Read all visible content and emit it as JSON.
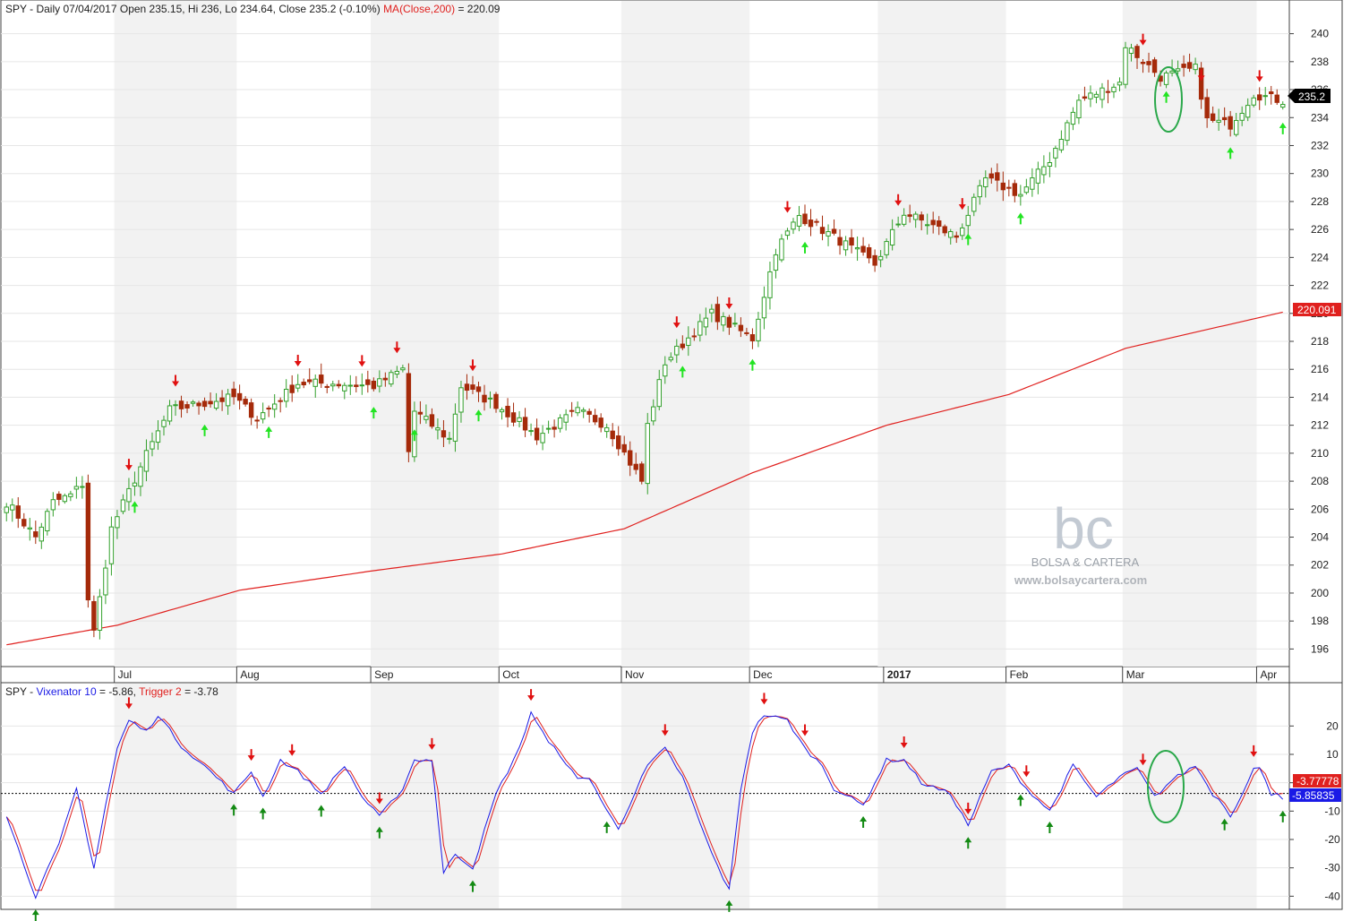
{
  "price_panel": {
    "header": {
      "prefix": "SPY - Daily 07/04/2017 Open 235.15, Hi 236, Lo 234.64, Close 235.2 (-0.10%)",
      "ma_label": "MA(Close,200)",
      "ma_value": "= 220.09"
    },
    "last_price_label": "235.2",
    "ma_price_label": "220.091"
  },
  "indicator_panel": {
    "header": {
      "prefix": "SPY - ",
      "vix_label": "Vixenator 10",
      "vix_value": "= -5.86,",
      "trigger_label": "Trigger 2",
      "trigger_value": "= -3.78"
    },
    "trigger_last_label": "-3.77778",
    "vix_last_label": "-5.85835"
  },
  "watermark": {
    "logo_letters": "bc",
    "name": "BOLSA & CARTERA",
    "url": "www.bolsaycartera.com"
  },
  "colors": {
    "up_candle": "#33a02c",
    "down_candle": "#a52a0a",
    "ma_line": "#e0201e",
    "vix_line": "#1a1ae6",
    "trigger_line": "#e0201e",
    "arrow_up_price": "#22e422",
    "arrow_up_indicator": "#138a13",
    "arrow_down": "#e01010",
    "circle": "#2aa84a",
    "shading": "#f2f2f2"
  },
  "chart_data": [
    {
      "type": "candlestick",
      "ylim": [
        195,
        241
      ],
      "y_ticks": [
        196,
        198,
        200,
        202,
        204,
        206,
        208,
        210,
        212,
        214,
        216,
        218,
        220,
        222,
        224,
        226,
        228,
        230,
        232,
        234,
        236,
        238,
        240
      ],
      "x_ticks": [
        {
          "label": "Jul",
          "date": "2016-07-01"
        },
        {
          "label": "Aug",
          "date": "2016-08-01"
        },
        {
          "label": "Sep",
          "date": "2016-09-01"
        },
        {
          "label": "Oct",
          "date": "2016-10-03"
        },
        {
          "label": "Nov",
          "date": "2016-11-01"
        },
        {
          "label": "Dec",
          "date": "2016-12-01"
        },
        {
          "label": "2017",
          "date": "2017-01-03"
        },
        {
          "label": "Feb",
          "date": "2017-02-01"
        },
        {
          "label": "Mar",
          "date": "2017-03-01"
        },
        {
          "label": "Apr",
          "date": "2017-04-03"
        }
      ],
      "shaded_months": [
        "2016-07",
        "2016-09",
        "2016-11",
        "2017-01",
        "2017-03"
      ],
      "close_anchors": [
        {
          "date": "2016-06-06",
          "close": 206.5
        },
        {
          "date": "2016-06-13",
          "close": 204.0
        },
        {
          "date": "2016-06-16",
          "close": 206.5
        },
        {
          "date": "2016-06-21",
          "close": 207.0
        },
        {
          "date": "2016-06-23",
          "close": 207.8
        },
        {
          "date": "2016-06-24",
          "close": 199.6
        },
        {
          "date": "2016-06-27",
          "close": 197.2
        },
        {
          "date": "2016-06-28",
          "close": 199.6
        },
        {
          "date": "2016-06-30",
          "close": 204.6
        },
        {
          "date": "2016-07-08",
          "close": 209.9
        },
        {
          "date": "2016-07-14",
          "close": 213.1
        },
        {
          "date": "2016-07-29",
          "close": 214.0
        },
        {
          "date": "2016-08-04",
          "close": 212.5
        },
        {
          "date": "2016-08-15",
          "close": 215.0
        },
        {
          "date": "2016-08-23",
          "close": 215.0
        },
        {
          "date": "2016-09-01",
          "close": 214.8
        },
        {
          "date": "2016-09-08",
          "close": 216.0
        },
        {
          "date": "2016-09-09",
          "close": 210.1
        },
        {
          "date": "2016-09-12",
          "close": 213.0
        },
        {
          "date": "2016-09-20",
          "close": 211.0
        },
        {
          "date": "2016-09-22",
          "close": 214.8
        },
        {
          "date": "2016-09-30",
          "close": 213.5
        },
        {
          "date": "2016-10-11",
          "close": 211.2
        },
        {
          "date": "2016-10-20",
          "close": 213.0
        },
        {
          "date": "2016-10-27",
          "close": 212.0
        },
        {
          "date": "2016-11-04",
          "close": 208.0
        },
        {
          "date": "2016-11-07",
          "close": 212.0
        },
        {
          "date": "2016-11-10",
          "close": 216.5
        },
        {
          "date": "2016-11-22",
          "close": 220.0
        },
        {
          "date": "2016-12-01",
          "close": 218.2
        },
        {
          "date": "2016-12-07",
          "close": 224.5
        },
        {
          "date": "2016-12-13",
          "close": 227.0
        },
        {
          "date": "2016-12-22",
          "close": 225.2
        },
        {
          "date": "2016-12-30",
          "close": 223.5
        },
        {
          "date": "2017-01-06",
          "close": 227.2
        },
        {
          "date": "2017-01-19",
          "close": 225.5
        },
        {
          "date": "2017-01-26",
          "close": 229.6
        },
        {
          "date": "2017-02-03",
          "close": 228.5
        },
        {
          "date": "2017-02-10",
          "close": 231.0
        },
        {
          "date": "2017-02-17",
          "close": 235.2
        },
        {
          "date": "2017-02-28",
          "close": 236.5
        },
        {
          "date": "2017-03-01",
          "close": 239.2
        },
        {
          "date": "2017-03-09",
          "close": 236.9
        },
        {
          "date": "2017-03-17",
          "close": 237.5
        },
        {
          "date": "2017-03-21",
          "close": 233.8
        },
        {
          "date": "2017-03-27",
          "close": 233.5
        },
        {
          "date": "2017-03-31",
          "close": 235.7
        },
        {
          "date": "2017-04-07",
          "close": 235.2
        }
      ],
      "ma_anchors": [
        {
          "date": "2016-06-06",
          "value": 196.3
        },
        {
          "date": "2016-07-01",
          "value": 197.7
        },
        {
          "date": "2016-08-01",
          "value": 200.2
        },
        {
          "date": "2016-09-01",
          "value": 201.6
        },
        {
          "date": "2016-10-03",
          "value": 202.8
        },
        {
          "date": "2016-11-01",
          "value": 204.6
        },
        {
          "date": "2016-12-01",
          "value": 208.6
        },
        {
          "date": "2017-01-03",
          "value": 212.0
        },
        {
          "date": "2017-02-01",
          "value": 214.2
        },
        {
          "date": "2017-03-01",
          "value": 217.5
        },
        {
          "date": "2017-04-07",
          "value": 220.09
        }
      ],
      "signals_down": [
        "2016-07-05",
        "2016-07-15",
        "2016-08-15",
        "2016-08-30",
        "2016-09-07",
        "2016-09-26",
        "2016-11-14",
        "2016-11-25",
        "2016-12-09",
        "2017-01-05",
        "2017-01-20",
        "2017-03-06",
        "2017-03-20",
        "2017-04-03"
      ],
      "signals_up": [
        "2016-07-06",
        "2016-07-22",
        "2016-08-08",
        "2016-09-01",
        "2016-09-12",
        "2016-09-27",
        "2016-11-15",
        "2016-12-01",
        "2016-12-14",
        "2017-01-23",
        "2017-02-03",
        "2017-03-10",
        "2017-03-27",
        "2017-04-07"
      ]
    },
    {
      "type": "line",
      "ylim": [
        -44,
        28
      ],
      "y_ticks": [
        -40,
        -30,
        -20,
        -10,
        0,
        10,
        20
      ],
      "reference_line": -3.78,
      "series": [
        {
          "name": "Vixenator 10",
          "anchors": [
            {
              "date": "2016-06-06",
              "value": -12
            },
            {
              "date": "2016-06-13",
              "value": -40
            },
            {
              "date": "2016-06-17",
              "value": -22
            },
            {
              "date": "2016-06-22",
              "value": -2
            },
            {
              "date": "2016-06-27",
              "value": -30
            },
            {
              "date": "2016-06-29",
              "value": -8
            },
            {
              "date": "2016-07-01",
              "value": 12
            },
            {
              "date": "2016-07-05",
              "value": 22
            },
            {
              "date": "2016-07-08",
              "value": 18
            },
            {
              "date": "2016-07-12",
              "value": 24
            },
            {
              "date": "2016-07-18",
              "value": 13
            },
            {
              "date": "2016-07-25",
              "value": 4
            },
            {
              "date": "2016-07-29",
              "value": -4
            },
            {
              "date": "2016-08-03",
              "value": 4
            },
            {
              "date": "2016-08-05",
              "value": -5
            },
            {
              "date": "2016-08-10",
              "value": 8
            },
            {
              "date": "2016-08-15",
              "value": 4
            },
            {
              "date": "2016-08-19",
              "value": -4
            },
            {
              "date": "2016-08-25",
              "value": 6
            },
            {
              "date": "2016-08-30",
              "value": -5
            },
            {
              "date": "2016-09-02",
              "value": -12
            },
            {
              "date": "2016-09-08",
              "value": -2
            },
            {
              "date": "2016-09-12",
              "value": 8
            },
            {
              "date": "2016-09-15",
              "value": 8
            },
            {
              "date": "2016-09-19",
              "value": -32
            },
            {
              "date": "2016-09-21",
              "value": -25
            },
            {
              "date": "2016-09-26",
              "value": -30
            },
            {
              "date": "2016-09-30",
              "value": -4
            },
            {
              "date": "2016-10-06",
              "value": 12
            },
            {
              "date": "2016-10-10",
              "value": 25
            },
            {
              "date": "2016-10-13",
              "value": 14
            },
            {
              "date": "2016-10-17",
              "value": 10
            },
            {
              "date": "2016-10-20",
              "value": 1
            },
            {
              "date": "2016-10-24",
              "value": 2
            },
            {
              "date": "2016-10-27",
              "value": -10
            },
            {
              "date": "2016-10-31",
              "value": -16
            },
            {
              "date": "2016-11-07",
              "value": 6
            },
            {
              "date": "2016-11-10",
              "value": 12
            },
            {
              "date": "2016-11-15",
              "value": 2
            },
            {
              "date": "2016-11-22",
              "value": -25
            },
            {
              "date": "2016-11-25",
              "value": -38
            },
            {
              "date": "2016-11-29",
              "value": -2
            },
            {
              "date": "2016-12-01",
              "value": 18
            },
            {
              "date": "2016-12-05",
              "value": 24
            },
            {
              "date": "2016-12-09",
              "value": 22
            },
            {
              "date": "2016-12-14",
              "value": 12
            },
            {
              "date": "2016-12-19",
              "value": 6
            },
            {
              "date": "2016-12-21",
              "value": -2
            },
            {
              "date": "2016-12-28",
              "value": -8
            },
            {
              "date": "2017-01-03",
              "value": 8
            },
            {
              "date": "2017-01-06",
              "value": 8
            },
            {
              "date": "2017-01-11",
              "value": 0
            },
            {
              "date": "2017-01-18",
              "value": -4
            },
            {
              "date": "2017-01-23",
              "value": -15
            },
            {
              "date": "2017-01-27",
              "value": 4
            },
            {
              "date": "2017-02-01",
              "value": 6
            },
            {
              "date": "2017-02-06",
              "value": -2
            },
            {
              "date": "2017-02-10",
              "value": -10
            },
            {
              "date": "2017-02-16",
              "value": 6
            },
            {
              "date": "2017-02-22",
              "value": -5
            },
            {
              "date": "2017-02-28",
              "value": 2
            },
            {
              "date": "2017-03-03",
              "value": 5
            },
            {
              "date": "2017-03-08",
              "value": -5
            },
            {
              "date": "2017-03-13",
              "value": 1
            },
            {
              "date": "2017-03-17",
              "value": 6
            },
            {
              "date": "2017-03-22",
              "value": -4
            },
            {
              "date": "2017-03-24",
              "value": -8
            },
            {
              "date": "2017-03-27",
              "value": -12
            },
            {
              "date": "2017-03-31",
              "value": 5
            },
            {
              "date": "2017-04-03",
              "value": 5
            },
            {
              "date": "2017-04-05",
              "value": -4
            },
            {
              "date": "2017-04-06",
              "value": -3
            },
            {
              "date": "2017-04-07",
              "value": -5.86
            }
          ]
        },
        {
          "name": "Trigger 2",
          "lag_days": 1,
          "last_value": -3.78
        }
      ],
      "signals_down": [
        "2016-07-05",
        "2016-08-03",
        "2016-08-12",
        "2016-09-02",
        "2016-09-15",
        "2016-10-10",
        "2016-11-10",
        "2016-12-05",
        "2016-12-14",
        "2017-01-06",
        "2017-01-23",
        "2017-02-06",
        "2017-03-06",
        "2017-03-31"
      ],
      "signals_up": [
        "2016-06-13",
        "2016-07-29",
        "2016-08-05",
        "2016-08-19",
        "2016-09-02",
        "2016-09-26",
        "2016-10-27",
        "2016-11-25",
        "2016-12-28",
        "2017-01-23",
        "2017-02-03",
        "2017-02-10",
        "2017-03-24",
        "2017-04-07"
      ]
    }
  ]
}
